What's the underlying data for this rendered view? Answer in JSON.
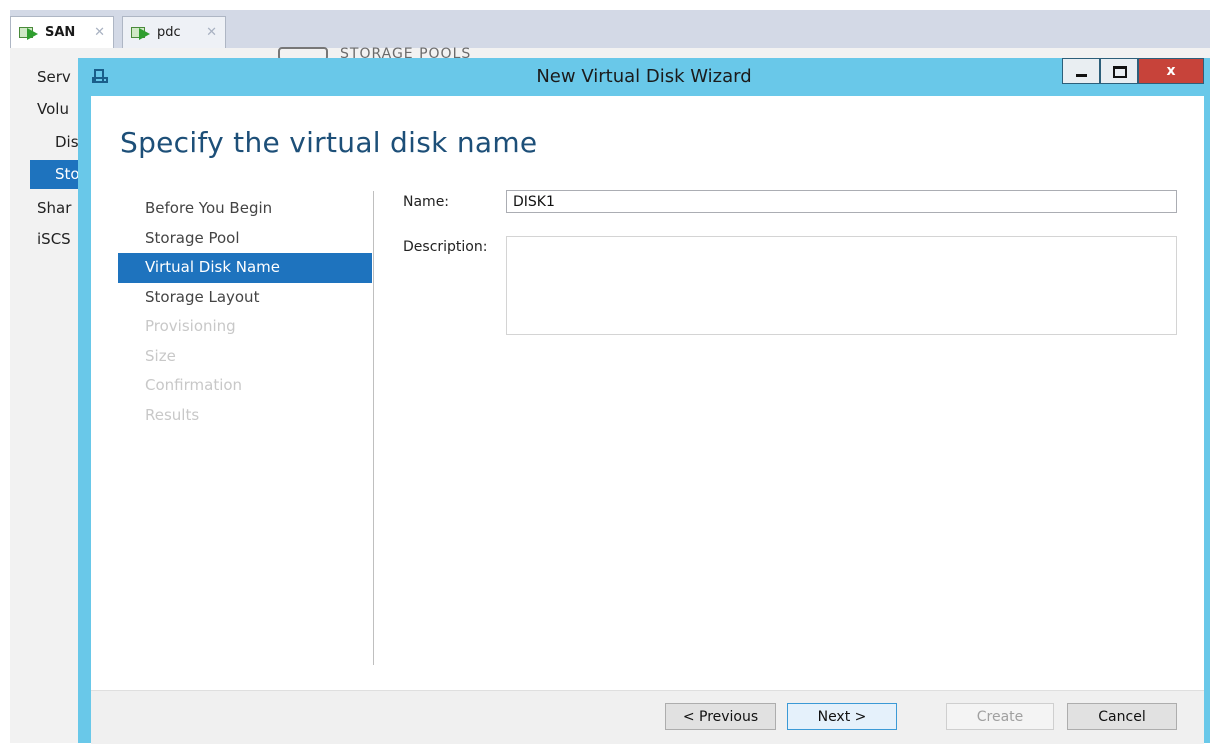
{
  "vm_tabs": [
    {
      "label": "SAN",
      "active": true
    },
    {
      "label": "pdc",
      "active": false
    }
  ],
  "background": {
    "page_title": "STORAGE POOLS",
    "nav_items": [
      {
        "label": "Servers",
        "visible": "Serv"
      },
      {
        "label": "Volumes",
        "visible": "Volu"
      },
      {
        "label": "Disks",
        "visible": "Dis"
      },
      {
        "label": "Storage Pools",
        "visible": "Sto",
        "selected": true
      },
      {
        "label": "Shares",
        "visible": "Shar"
      },
      {
        "label": "iSCSI",
        "visible": "iSCS"
      }
    ]
  },
  "wizard": {
    "title": "New Virtual Disk Wizard",
    "heading": "Specify the virtual disk name",
    "steps": [
      {
        "label": "Before You Begin",
        "state": "done"
      },
      {
        "label": "Storage Pool",
        "state": "done"
      },
      {
        "label": "Virtual Disk Name",
        "state": "current"
      },
      {
        "label": "Storage Layout",
        "state": "enabled"
      },
      {
        "label": "Provisioning",
        "state": "disabled"
      },
      {
        "label": "Size",
        "state": "disabled"
      },
      {
        "label": "Confirmation",
        "state": "disabled"
      },
      {
        "label": "Results",
        "state": "disabled"
      }
    ],
    "form": {
      "name_label": "Name:",
      "name_value": "DISK1",
      "description_label": "Description:",
      "description_value": ""
    },
    "buttons": {
      "previous": "< Previous",
      "next": "Next >",
      "create": "Create",
      "cancel": "Cancel"
    },
    "window_controls": {
      "close_glyph": "x"
    }
  },
  "colors": {
    "accent": "#1e73be",
    "titlebar": "#69c8e9",
    "close_button": "#c7433a",
    "heading": "#1d4f78"
  }
}
